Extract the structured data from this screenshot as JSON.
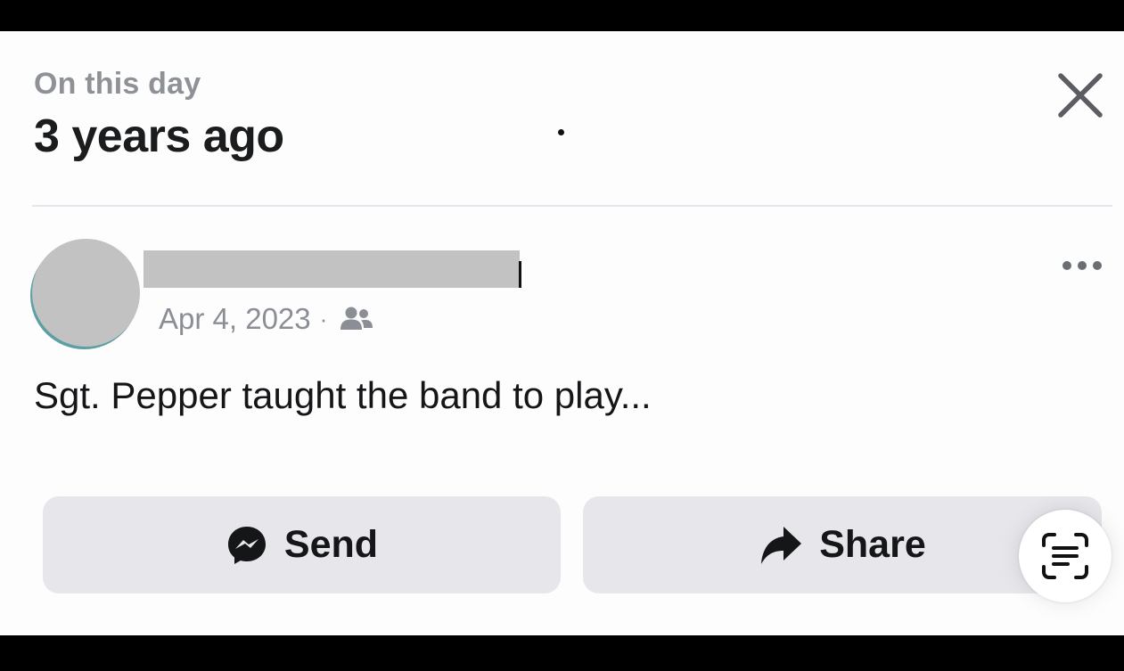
{
  "memory": {
    "eyebrow": "On this day",
    "headline": "3 years ago"
  },
  "post": {
    "date": "Apr 4, 2023",
    "separator": "·",
    "audience_icon": "friends-icon",
    "text": "Sgt. Pepper taught the band to play..."
  },
  "actions": {
    "send_label": "Send",
    "share_label": "Share"
  },
  "icons": {
    "close": "close-icon",
    "more": "more-options-icon",
    "send": "messenger-icon",
    "share": "share-arrow-icon",
    "scan": "live-text-scan-icon"
  },
  "colors": {
    "background": "#fdfdfe",
    "button": "#e6e6eb",
    "muted_text": "#8e9196",
    "primary_text": "#1b1c1e",
    "divider": "#e4e6ee",
    "redaction": "#c2c2c2"
  }
}
